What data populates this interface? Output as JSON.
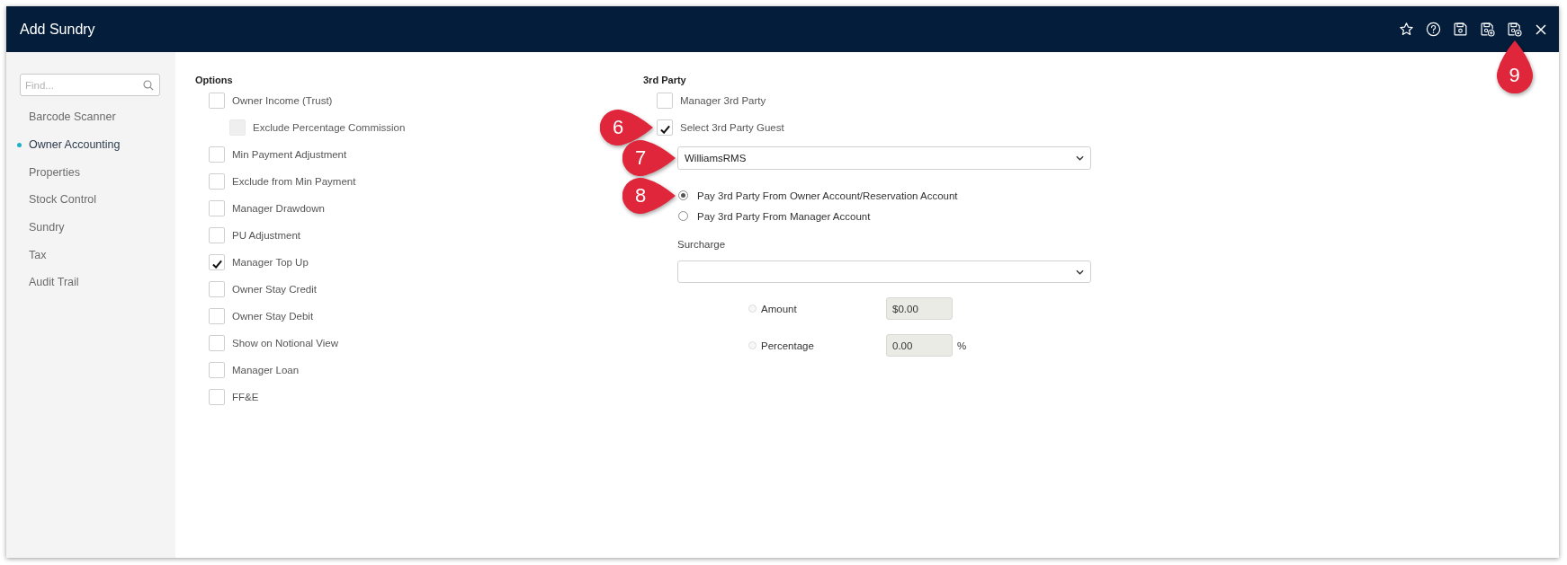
{
  "window": {
    "title": "Add Sundry",
    "callout": "9"
  },
  "sidebar": {
    "search": {
      "placeholder": "Find..."
    },
    "items": [
      {
        "label": "Barcode Scanner",
        "selected": false
      },
      {
        "label": "Owner Accounting",
        "selected": true
      },
      {
        "label": "Properties",
        "selected": false
      },
      {
        "label": "Stock Control",
        "selected": false
      },
      {
        "label": "Sundry",
        "selected": false
      },
      {
        "label": "Tax",
        "selected": false
      },
      {
        "label": "Audit Trail",
        "selected": false
      }
    ]
  },
  "options": {
    "title": "Options",
    "items": [
      {
        "label": "Owner Income (Trust)",
        "checked": false,
        "disabled": false,
        "children": [
          {
            "label": "Exclude Percentage Commission",
            "checked": false,
            "disabled": true
          }
        ]
      },
      {
        "label": "Min Payment Adjustment",
        "checked": false,
        "disabled": false
      },
      {
        "label": "Exclude from Min Payment",
        "checked": false,
        "disabled": false
      },
      {
        "label": "Manager Drawdown",
        "checked": false,
        "disabled": false
      },
      {
        "label": "PU Adjustment",
        "checked": false,
        "disabled": false
      },
      {
        "label": "Manager Top Up",
        "checked": true,
        "disabled": false
      },
      {
        "label": "Owner Stay Credit",
        "checked": false,
        "disabled": false
      },
      {
        "label": "Owner Stay Debit",
        "checked": false,
        "disabled": false
      },
      {
        "label": "Show on Notional View",
        "checked": false,
        "disabled": false
      },
      {
        "label": "Manager Loan",
        "checked": false,
        "disabled": false
      },
      {
        "label": "FF&E",
        "checked": false,
        "disabled": false
      }
    ]
  },
  "third_party": {
    "title": "3rd Party",
    "items": [
      {
        "label": "Manager 3rd Party",
        "checked": false,
        "disabled": false
      },
      {
        "label": "Select 3rd Party Guest",
        "checked": true,
        "disabled": false,
        "callout": "6"
      }
    ],
    "guest": {
      "value": "WilliamsRMS",
      "callout": "7"
    },
    "pay_from": [
      {
        "label": "Pay 3rd Party From Owner Account/Reservation Account",
        "selected": true,
        "callout": "8"
      },
      {
        "label": "Pay 3rd Party From Manager Account",
        "selected": false
      }
    ],
    "surcharge": {
      "label": "Surcharge"
    },
    "surcharge_types": [
      {
        "label": "Amount",
        "selected": false,
        "disabled": true,
        "value": "$0.00"
      },
      {
        "label": "Percentage",
        "selected": false,
        "disabled": true,
        "value": "0.00",
        "unit": "%"
      }
    ]
  }
}
